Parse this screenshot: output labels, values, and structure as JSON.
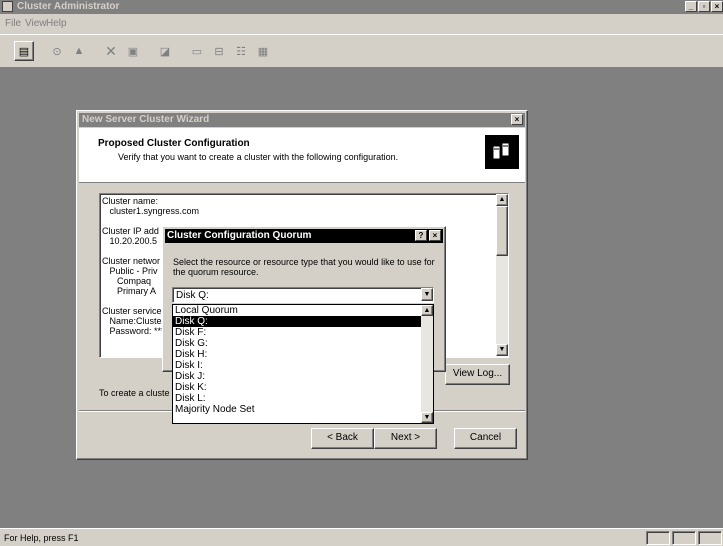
{
  "app": {
    "title": "Cluster Administrator",
    "menu": [
      "File",
      "View",
      "Help"
    ],
    "status": "For Help, press F1"
  },
  "wizard": {
    "title": "New Server Cluster Wizard",
    "heading": "Proposed Cluster Configuration",
    "subheading": "Verify that you want to create a cluster with the following configuration.",
    "config_lines": [
      "Cluster name:",
      "   cluster1.syngress.com",
      "",
      "Cluster IP add",
      "   10.20.200.5",
      "",
      "Cluster networ",
      "   Public - Priv",
      "      Compaq",
      "      Primary A",
      "",
      "Cluster service",
      "   Name:Cluster",
      "   Password: ***"
    ],
    "create_text": "To create a cluste",
    "view_log": "View Log...",
    "back": "< Back",
    "next": "Next >",
    "cancel": "Cancel"
  },
  "quorum": {
    "title": "Cluster Configuration Quorum",
    "help_btn": "?",
    "close_btn": "×",
    "prompt": "Select the resource or resource type that you would like to use for the quorum resource.",
    "selected": "Disk Q:",
    "options": [
      "Local Quorum",
      "Disk Q:",
      "Disk F:",
      "Disk G:",
      "Disk H:",
      "Disk I:",
      "Disk J:",
      "Disk K:",
      "Disk L:",
      "Majority Node Set"
    ],
    "selected_index": 1
  }
}
